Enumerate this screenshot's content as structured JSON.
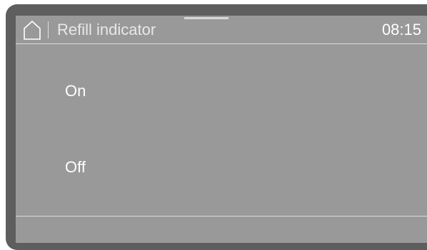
{
  "header": {
    "home_icon": "home-icon",
    "title": "Refill indicator",
    "clock": "08:15"
  },
  "options": [
    {
      "label": "On"
    },
    {
      "label": "Off"
    }
  ],
  "colors": {
    "screen_background": "#999999",
    "bezel": "#5e5e5e",
    "text": "#ffffff",
    "divider": "#dcdcdc"
  }
}
